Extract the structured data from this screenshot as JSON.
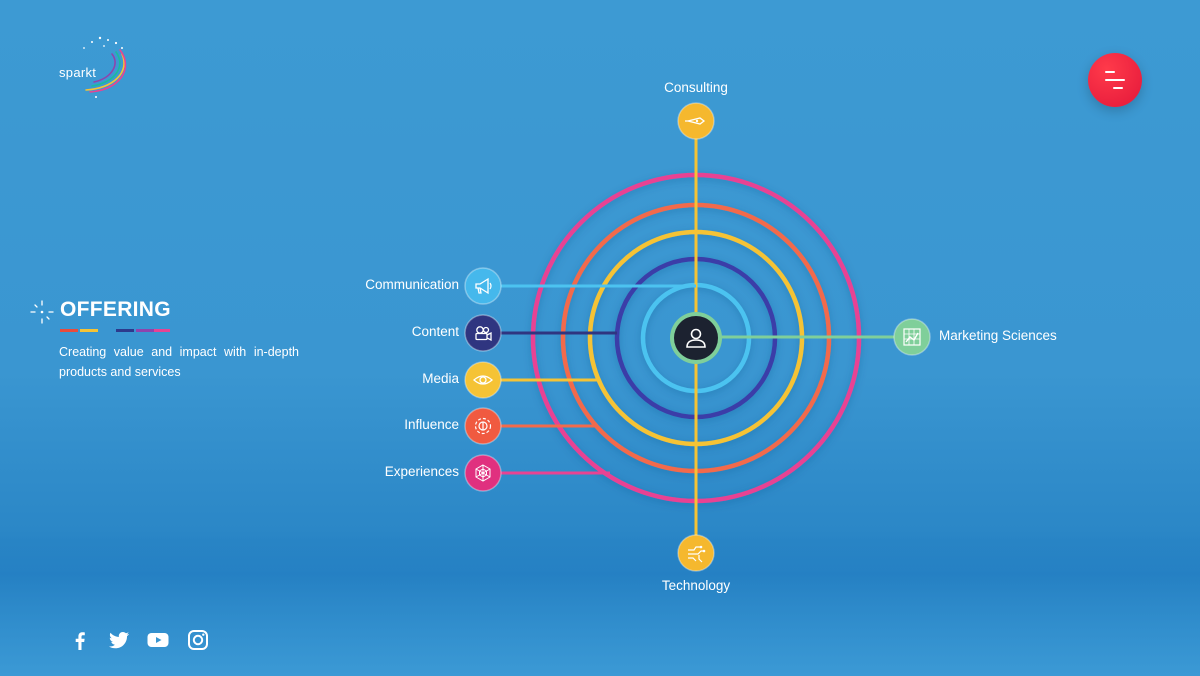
{
  "brand": {
    "logo_text": "sparkt"
  },
  "section": {
    "title": "OFFERING",
    "description": "Creating value and impact with in-depth products and services",
    "underline_colors": [
      "#e94b3c",
      "#f5c335",
      "#2d3a8c",
      "#8e44ad",
      "#e84393",
      "#1abc9c"
    ]
  },
  "menu": {
    "icon": "menu-icon",
    "color": "#e3173a"
  },
  "diagram": {
    "center_icon": "user-icon",
    "rings": [
      {
        "name": "ring-1",
        "color": "#e84393"
      },
      {
        "name": "ring-2",
        "color": "#f26a4b"
      },
      {
        "name": "ring-3",
        "color": "#f5c335"
      },
      {
        "name": "ring-4",
        "color": "#3b3ea8"
      },
      {
        "name": "ring-5",
        "color": "#4cc3f0"
      }
    ],
    "nodes": [
      {
        "key": "consulting",
        "label": "Consulting",
        "icon": "pen-icon",
        "color": "#f5b82e"
      },
      {
        "key": "communication",
        "label": "Communication",
        "icon": "megaphone-icon",
        "color": "#45b8ec"
      },
      {
        "key": "content",
        "label": "Content",
        "icon": "video-camera-icon",
        "color": "#2f3580"
      },
      {
        "key": "media",
        "label": "Media",
        "icon": "eye-icon",
        "color": "#f5c335"
      },
      {
        "key": "influence",
        "label": "Influence",
        "icon": "influence-icon",
        "color": "#f05a40"
      },
      {
        "key": "experiences",
        "label": "Experiences",
        "icon": "web-icon",
        "color": "#e0307f"
      },
      {
        "key": "marketing_sciences",
        "label": "Marketing Sciences",
        "icon": "chart-grid-icon",
        "color": "#7fcf9a"
      },
      {
        "key": "technology",
        "label": "Technology",
        "icon": "circuit-icon",
        "color": "#f5b82e"
      }
    ]
  },
  "social": [
    {
      "name": "facebook-icon"
    },
    {
      "name": "twitter-icon"
    },
    {
      "name": "youtube-icon"
    },
    {
      "name": "instagram-icon"
    }
  ]
}
